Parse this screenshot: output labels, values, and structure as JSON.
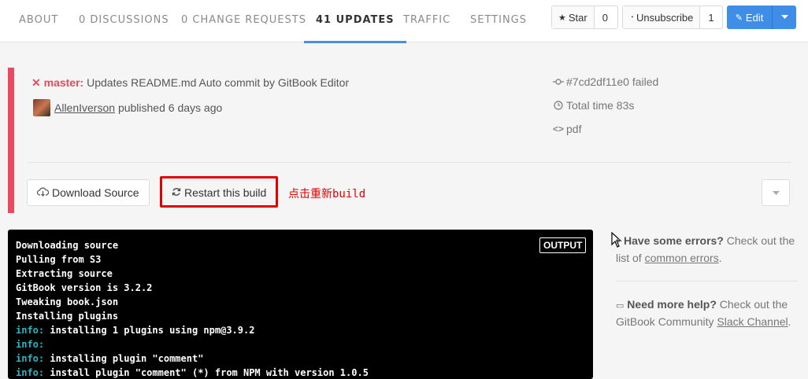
{
  "nav": {
    "tabs": [
      {
        "label": "ABOUT"
      },
      {
        "label": "0 DISCUSSIONS"
      },
      {
        "label": "0 CHANGE REQUESTS"
      },
      {
        "label": "41 UPDATES"
      },
      {
        "label": "TRAFFIC"
      },
      {
        "label": "SETTINGS"
      }
    ],
    "star_label": "Star",
    "star_count": "0",
    "unsubscribe_label": "Unsubscribe",
    "unsubscribe_count": "1",
    "edit_label": "Edit"
  },
  "build": {
    "branch": "master:",
    "commit_message": "Updates README.md Auto commit by GitBook Editor",
    "author": "AllenIverson",
    "published": "published 6 days ago",
    "commit_status": "#7cd2df11e0 failed",
    "total_time": "Total time 83s",
    "format": "pdf",
    "download_label": "Download Source",
    "restart_label": "Restart this build",
    "annotation": "点击重新build",
    "status_color": "#e84a5f"
  },
  "output": {
    "badge": "OUTPUT",
    "lines": [
      {
        "prefix": "",
        "text": "Downloading source"
      },
      {
        "prefix": "",
        "text": "Pulling from S3"
      },
      {
        "prefix": "",
        "text": "Extracting source"
      },
      {
        "prefix": "",
        "text": "GitBook version is 3.2.2"
      },
      {
        "prefix": "",
        "text": "Tweaking book.json"
      },
      {
        "prefix": "",
        "text": "Installing plugins"
      },
      {
        "prefix": "info:",
        "text": " installing 1 plugins using npm@3.9.2"
      },
      {
        "prefix": "info:",
        "text": ""
      },
      {
        "prefix": "info:",
        "text": " installing plugin \"comment\""
      },
      {
        "prefix": "info:",
        "text": " install plugin \"comment\" (*) from NPM with version 1.0.5"
      }
    ]
  },
  "help": {
    "errors_title": "Have some errors?",
    "errors_text": " Check out the list of ",
    "errors_link": "common errors",
    "errors_end": ".",
    "more_title": "Need more help?",
    "more_text": " Check out the GitBook Community ",
    "more_link": "Slack Channel",
    "more_end": "."
  }
}
